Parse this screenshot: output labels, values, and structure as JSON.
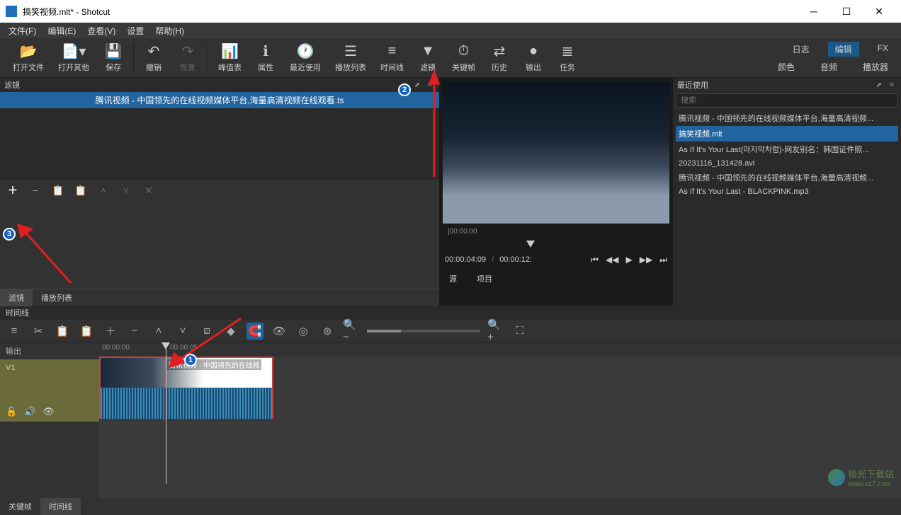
{
  "window": {
    "title": "搞笑视频.mlt* - Shotcut"
  },
  "menubar": [
    "文件(F)",
    "编辑(E)",
    "查看(V)",
    "设置",
    "帮助(H)"
  ],
  "toolbar": [
    {
      "label": "打开文件",
      "icon": "📂"
    },
    {
      "label": "打开其他",
      "icon": "📄"
    },
    {
      "label": "保存",
      "icon": "💾"
    },
    {
      "label": "撤销",
      "icon": "↶"
    },
    {
      "label": "恢复",
      "icon": "↷",
      "disabled": true
    },
    {
      "label": "峰值表",
      "icon": "📊"
    },
    {
      "label": "属性",
      "icon": "ℹ"
    },
    {
      "label": "最近使用",
      "icon": "🕐"
    },
    {
      "label": "播放列表",
      "icon": "☰"
    },
    {
      "label": "时间线",
      "icon": "≡"
    },
    {
      "label": "滤镜",
      "icon": "▼"
    },
    {
      "label": "关键帧",
      "icon": "⏱"
    },
    {
      "label": "历史",
      "icon": "⇄"
    },
    {
      "label": "输出",
      "icon": "●"
    },
    {
      "label": "任务",
      "icon": "≣"
    }
  ],
  "toolbar_tabs_top": {
    "items": [
      "日志",
      "编辑",
      "FX"
    ],
    "active": "编辑"
  },
  "toolbar_tabs_bottom": {
    "items": [
      "颜色",
      "音频",
      "播放器"
    ]
  },
  "filter_panel": {
    "title": "滤镜",
    "item": "腾讯视频 - 中国领先的在线视频媒体平台,海量高清视频在线观看.ts",
    "toolbar_icons": [
      "＋",
      "−",
      "📋",
      "📋",
      "▲",
      "▼",
      "✕"
    ]
  },
  "left_tabs": {
    "items": [
      "滤镜",
      "播放列表"
    ],
    "active": "滤镜"
  },
  "preview": {
    "ruler_start": "00:00:00",
    "current_time": "00:00:04:09",
    "total_time": "00:00:12:",
    "tabs": {
      "items": [
        "源",
        "项目"
      ],
      "active": "源"
    }
  },
  "recent": {
    "title": "最近使用",
    "search_placeholder": "搜索",
    "items": [
      "腾讯视频 - 中国领先的在线视频媒体平台,海量高清视频...",
      "搞笑视频.mlt",
      "As If It's Your Last(마지막처럼)-网友别名：韩国证件照...",
      "20231116_131428.avi",
      "腾讯视频 - 中国领先的在线视频媒体平台,海量高清视频...",
      "As If It's Your Last - BLACKPINK.mp3"
    ],
    "selected_index": 1
  },
  "timeline": {
    "title": "时间线",
    "output_label": "输出",
    "track_label": "V1",
    "ruler": [
      "00:00:00",
      "00:00:05"
    ],
    "clip_label": "腾讯视频 - 中国领先的在线视",
    "tabs": {
      "items": [
        "关键帧",
        "时间线"
      ],
      "active": "时间线"
    }
  },
  "annotations": {
    "n1": "1",
    "n2": "2",
    "n3": "3"
  },
  "watermark": {
    "text": "极光下载站",
    "url": "www.xz7.com"
  }
}
